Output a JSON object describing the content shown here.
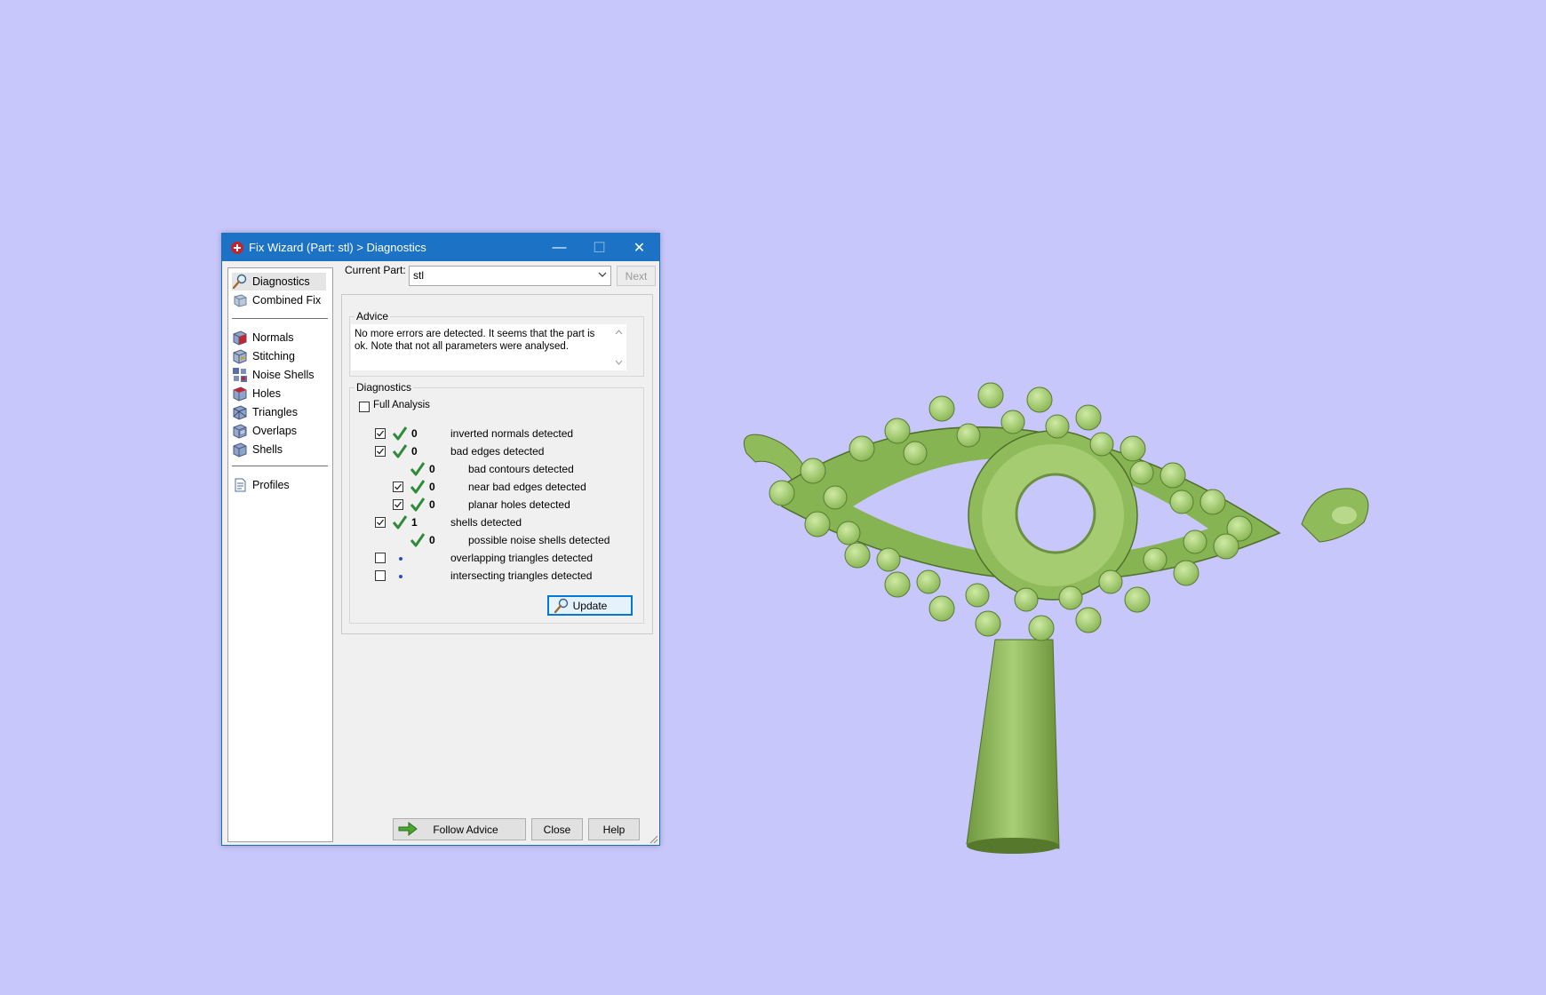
{
  "window": {
    "title": "Fix Wizard (Part: stl) > Diagnostics",
    "minimize": "—",
    "maximize": "☐",
    "close": "✕"
  },
  "nav": {
    "items": [
      {
        "label": "Diagnostics",
        "icon": "magnifier-icon",
        "selected": true
      },
      {
        "label": "Combined Fix",
        "icon": "cube-icon"
      },
      {
        "label": "Normals",
        "icon": "normals-cube-icon"
      },
      {
        "label": "Stitching",
        "icon": "stitching-cube-icon"
      },
      {
        "label": "Noise Shells",
        "icon": "noise-shells-icon"
      },
      {
        "label": "Holes",
        "icon": "holes-cube-icon"
      },
      {
        "label": "Triangles",
        "icon": "triangles-cube-icon"
      },
      {
        "label": "Overlaps",
        "icon": "overlaps-cube-icon"
      },
      {
        "label": "Shells",
        "icon": "shells-cube-icon"
      },
      {
        "label": "Profiles",
        "icon": "profiles-icon"
      }
    ]
  },
  "toolbar": {
    "current_part_label": "Current Part:",
    "current_part_value": "stl",
    "next_label": "Next"
  },
  "advice": {
    "title": "Advice",
    "text": "No more errors are detected. It seems that the part is ok. Note that not all parameters were analysed."
  },
  "diagnostics": {
    "title": "Diagnostics",
    "full_analysis_label": "Full Analysis",
    "full_analysis_checked": false,
    "rows": [
      {
        "checkbox": true,
        "checked": true,
        "status": "ok",
        "count": "0",
        "label": "inverted normals detected"
      },
      {
        "checkbox": true,
        "checked": true,
        "status": "ok",
        "count": "0",
        "label": "bad edges detected"
      },
      {
        "checkbox": false,
        "status": "ok",
        "count": "0",
        "label": "bad contours detected"
      },
      {
        "checkbox": true,
        "checked": true,
        "status": "ok",
        "count": "0",
        "label": "near bad edges detected"
      },
      {
        "checkbox": true,
        "checked": true,
        "status": "ok",
        "count": "0",
        "label": "planar holes detected"
      },
      {
        "checkbox": true,
        "checked": true,
        "status": "ok",
        "count": "1",
        "label": "shells detected"
      },
      {
        "checkbox": false,
        "status": "ok",
        "count": "0",
        "label": "possible noise shells detected"
      },
      {
        "checkbox": true,
        "checked": false,
        "status": "pending",
        "count": "",
        "label": "overlapping triangles detected"
      },
      {
        "checkbox": true,
        "checked": false,
        "status": "pending",
        "count": "",
        "label": "intersecting triangles detected"
      }
    ],
    "update_label": "Update"
  },
  "footer": {
    "follow_advice_label": "Follow Advice",
    "close_label": "Close",
    "help_label": "Help"
  },
  "colors": {
    "background": "#c7c7fb",
    "titlebar": "#1c73c5",
    "model_green": "#9cc46a",
    "check_green": "#2e8b3a"
  }
}
